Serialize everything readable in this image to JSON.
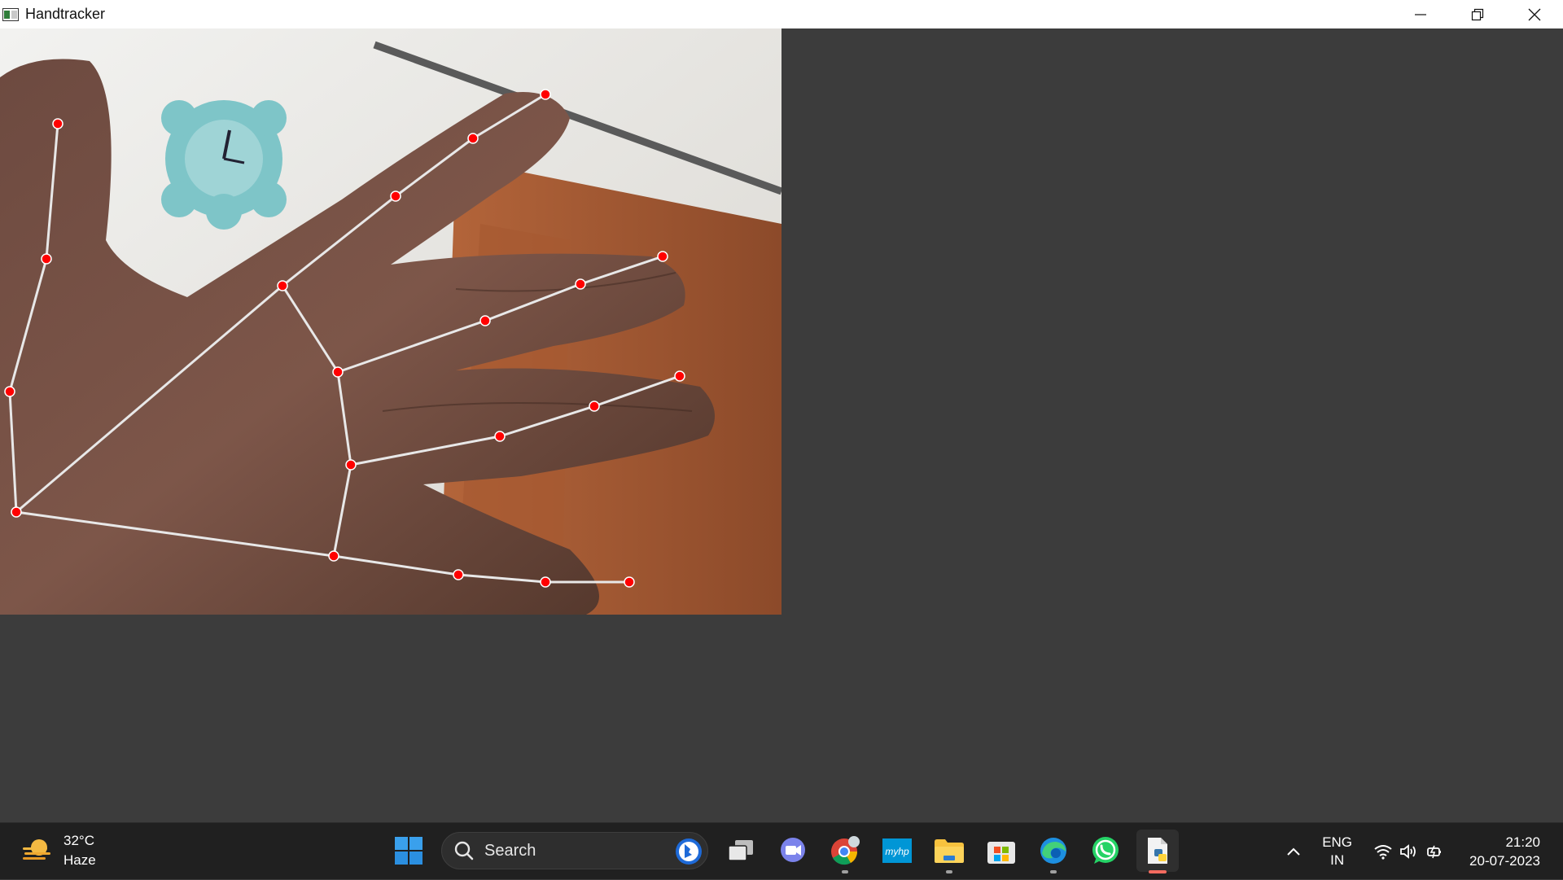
{
  "window": {
    "title": "Handtracker",
    "controls": [
      "minimize",
      "restore",
      "close"
    ]
  },
  "taskbar": {
    "weather": {
      "temperature": "32°C",
      "condition": "Haze",
      "icon": "weather-haze-icon"
    },
    "search": {
      "label": "Search"
    },
    "apps": [
      "start",
      "task-view",
      "teams-chat",
      "chrome",
      "myhp",
      "file-explorer",
      "microsoft-store",
      "edge",
      "whatsapp",
      "python"
    ],
    "tray": {
      "language": "ENG",
      "region": "IN",
      "time": "21:20",
      "date": "20-07-2023"
    }
  },
  "colors": {
    "landmark": "#ff0000",
    "connection": "#e8e8e8",
    "window_background": "#3c3c3c",
    "taskbar": "#202020"
  }
}
